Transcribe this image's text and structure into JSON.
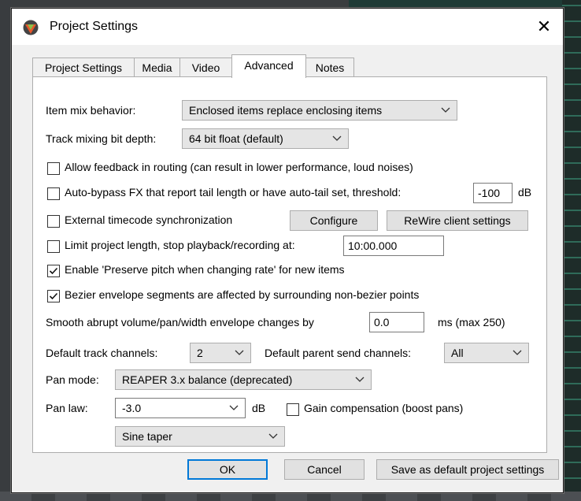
{
  "window": {
    "title": "Project Settings",
    "close_glyph": "✕"
  },
  "tabs": [
    {
      "label": "Project Settings",
      "active": false
    },
    {
      "label": "Media",
      "active": false
    },
    {
      "label": "Video",
      "active": false
    },
    {
      "label": "Advanced",
      "active": true
    },
    {
      "label": "Notes",
      "active": false
    }
  ],
  "advanced": {
    "item_mix": {
      "label": "Item mix behavior:",
      "value": "Enclosed items replace enclosing items"
    },
    "bit_depth": {
      "label": "Track mixing bit depth:",
      "value": "64 bit float (default)"
    },
    "feedback": {
      "label": "Allow feedback in routing (can result in lower performance, loud noises)",
      "checked": false
    },
    "autobypass": {
      "label": "Auto-bypass FX that report tail length or have auto-tail set, threshold:",
      "checked": false,
      "value": "-100",
      "unit": "dB"
    },
    "ext_timecode": {
      "label": "External timecode synchronization",
      "checked": false,
      "configure_label": "Configure",
      "rewire_label": "ReWire client settings"
    },
    "limit_length": {
      "label": "Limit project length, stop playback/recording at:",
      "checked": false,
      "value": "10:00.000"
    },
    "preserve_pitch": {
      "label": "Enable 'Preserve pitch when changing rate' for new items",
      "checked": true
    },
    "bezier": {
      "label": "Bezier envelope segments are affected by surrounding non-bezier points",
      "checked": true
    },
    "smooth": {
      "label": "Smooth abrupt volume/pan/width envelope changes by",
      "value": "0.0",
      "suffix": "ms (max 250)"
    },
    "track_channels": {
      "label": "Default track channels:",
      "value": "2"
    },
    "parent_send": {
      "label": "Default parent send channels:",
      "value": "All"
    },
    "pan_mode": {
      "label": "Pan mode:",
      "value": "REAPER 3.x balance (deprecated)"
    },
    "pan_law": {
      "label": "Pan law:",
      "value": "-3.0",
      "unit": "dB"
    },
    "gain_comp": {
      "label": "Gain compensation (boost pans)",
      "checked": false
    },
    "taper": {
      "value": "Sine taper"
    }
  },
  "footer": {
    "ok_label": "OK",
    "cancel_label": "Cancel",
    "save_default_label": "Save as default project settings"
  },
  "colors": {
    "accent": "#0078d7",
    "panel": "#ffffff",
    "dialog": "#f0f0f0"
  }
}
